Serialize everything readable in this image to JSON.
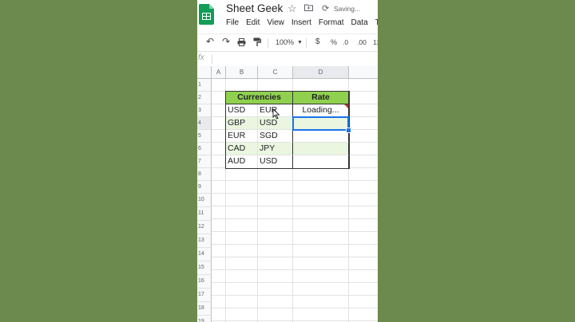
{
  "colors": {
    "accent": "#1a73e8",
    "header_fill": "#8fd14f",
    "row_fill": "#eaf6e0",
    "sheets_green": "#0f9d58"
  },
  "doc": {
    "title": "Sheet Geek",
    "status": "Saving...",
    "star_icon": "star-icon",
    "folder_icon": "folder-icon",
    "sync_icon": "cloud-sync-icon"
  },
  "menu": [
    "File",
    "Edit",
    "View",
    "Insert",
    "Format",
    "Data",
    "T"
  ],
  "toolbar": {
    "undo": "↶",
    "redo": "↷",
    "zoom": "100%",
    "currency": "$",
    "percent": "%",
    "dec_decrease": ".0",
    "dec_increase": ".00",
    "more": "12"
  },
  "formula_bar": {
    "fx_label": "fx",
    "value": ""
  },
  "columns": [
    "A",
    "B",
    "C",
    "D"
  ],
  "rows": [
    "1",
    "2",
    "3",
    "4",
    "5",
    "6",
    "7",
    "8",
    "9",
    "10",
    "11",
    "12",
    "13",
    "14",
    "15",
    "16",
    "17",
    "18",
    "19"
  ],
  "table": {
    "header": {
      "currencies": "Currencies",
      "rate": "Rate"
    },
    "rows": [
      {
        "from": "USD",
        "to": "EUR",
        "rate": "Loading..."
      },
      {
        "from": "GBP",
        "to": "USD",
        "rate": ""
      },
      {
        "from": "EUR",
        "to": "SGD",
        "rate": ""
      },
      {
        "from": "CAD",
        "to": "JPY",
        "rate": ""
      },
      {
        "from": "AUD",
        "to": "USD",
        "rate": ""
      }
    ]
  },
  "selected_cell": "D4"
}
